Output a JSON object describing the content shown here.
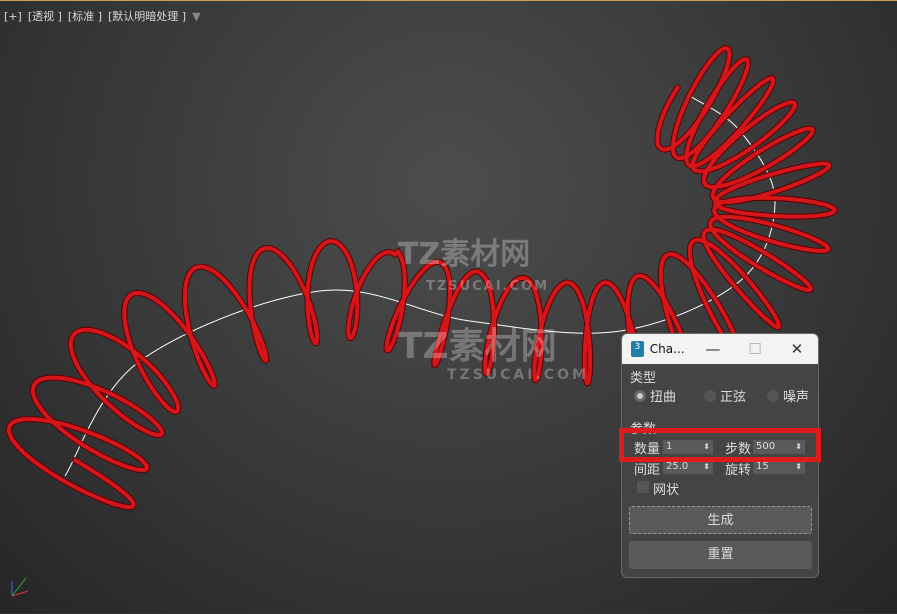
{
  "viewport": {
    "labels": [
      "[+]",
      "[透视 ]",
      "[标准 ]",
      "[默认明暗处理 ]"
    ],
    "filter_icon": "funnel-icon"
  },
  "watermark": {
    "brand": "TZ素材网",
    "url": "TZSUCAI.COM"
  },
  "dialog": {
    "title": "Cha...",
    "app_icon": "3",
    "minimize": "—",
    "maximize": "☐",
    "close": "✕",
    "type_group": "类型",
    "types": [
      {
        "label": "扭曲",
        "selected": true
      },
      {
        "label": "正弦",
        "selected": false
      },
      {
        "label": "噪声",
        "selected": false
      }
    ],
    "params_group": "参数",
    "fields": {
      "count_label": "数量",
      "count": "1",
      "steps_label": "步数",
      "steps": "500",
      "spacing_label": "间距",
      "spacing": "25.0",
      "rotate_label": "旋转",
      "rotate": "15"
    },
    "mesh_label": "网状",
    "mesh_checked": false,
    "generate": "生成",
    "reset": "重置"
  },
  "colors": {
    "spring": "#d4161a",
    "highlight": "#e01b1b"
  }
}
